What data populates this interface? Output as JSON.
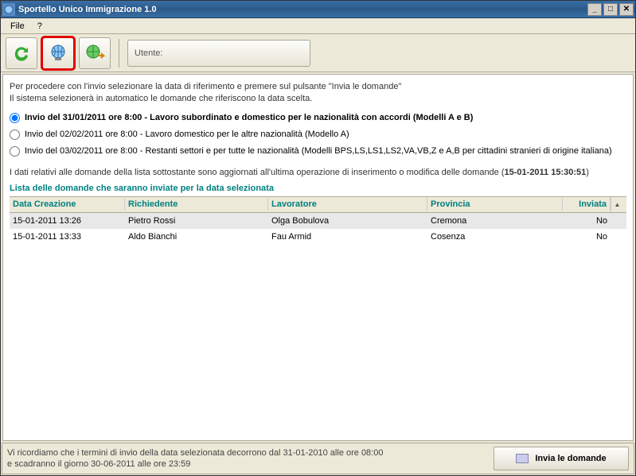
{
  "window": {
    "title": "Sportello Unico Immigrazione 1.0"
  },
  "menu": {
    "file": "File",
    "help": "?"
  },
  "toolbar": {
    "refresh_icon": "refresh-icon",
    "globe_icon": "globe-icon",
    "world_send_icon": "world-send-icon",
    "user_label": "Utente:",
    "user_value": ""
  },
  "instructions": {
    "line1": "Per procedere con l'invio selezionare la data di riferimento e premere sul pulsante \"Invia le domande\"",
    "line2": "Il sistema selezionerà in automatico le domande che riferiscono la data scelta."
  },
  "options": [
    {
      "label": "Invio del 31/01/2011 ore 8:00 - Lavoro subordinato e domestico per le nazionalità con accordi (Modelli A e B)",
      "selected": true,
      "bold": true
    },
    {
      "label": "Invio del 02/02/2011 ore 8:00 - Lavoro domestico per le altre nazionalità (Modello A)",
      "selected": false,
      "bold": false
    },
    {
      "label": "Invio del 03/02/2011 ore 8:00 - Restanti settori e per tutte le nazionalità (Modelli BPS,LS,LS1,LS2,VA,VB,Z e A,B per cittadini stranieri di origine italiana)",
      "selected": false,
      "bold": false
    }
  ],
  "note": {
    "prefix": "I dati relativi alle domande della lista sottostante sono aggiornati all'ultima operazione di inserimento o modifica delle domande (",
    "timestamp": "15-01-2011 15:30:51",
    "suffix": ")"
  },
  "list_title": "Lista delle domande che saranno inviate per la data selezionata",
  "columns": {
    "data_creazione": "Data Creazione",
    "richiedente": "Richiedente",
    "lavoratore": "Lavoratore",
    "provincia": "Provincia",
    "inviata": "Inviata"
  },
  "rows": [
    {
      "data_creazione": "15-01-2011 13:26",
      "richiedente": "Pietro Rossi",
      "lavoratore": "Olga Bobulova",
      "provincia": "Cremona",
      "inviata": "No",
      "selected": true
    },
    {
      "data_creazione": "15-01-2011 13:33",
      "richiedente": "Aldo Bianchi",
      "lavoratore": "Fau Armid",
      "provincia": "Cosenza",
      "inviata": "No",
      "selected": false
    }
  ],
  "footer": {
    "line1": "Vi ricordiamo che i termini di invio della data selezionata decorrono dal 31-01-2010 alle ore 08:00",
    "line2": "e scadranno il giorno 30-06-2011 alle ore 23:59",
    "send_label": "Invia le domande"
  }
}
